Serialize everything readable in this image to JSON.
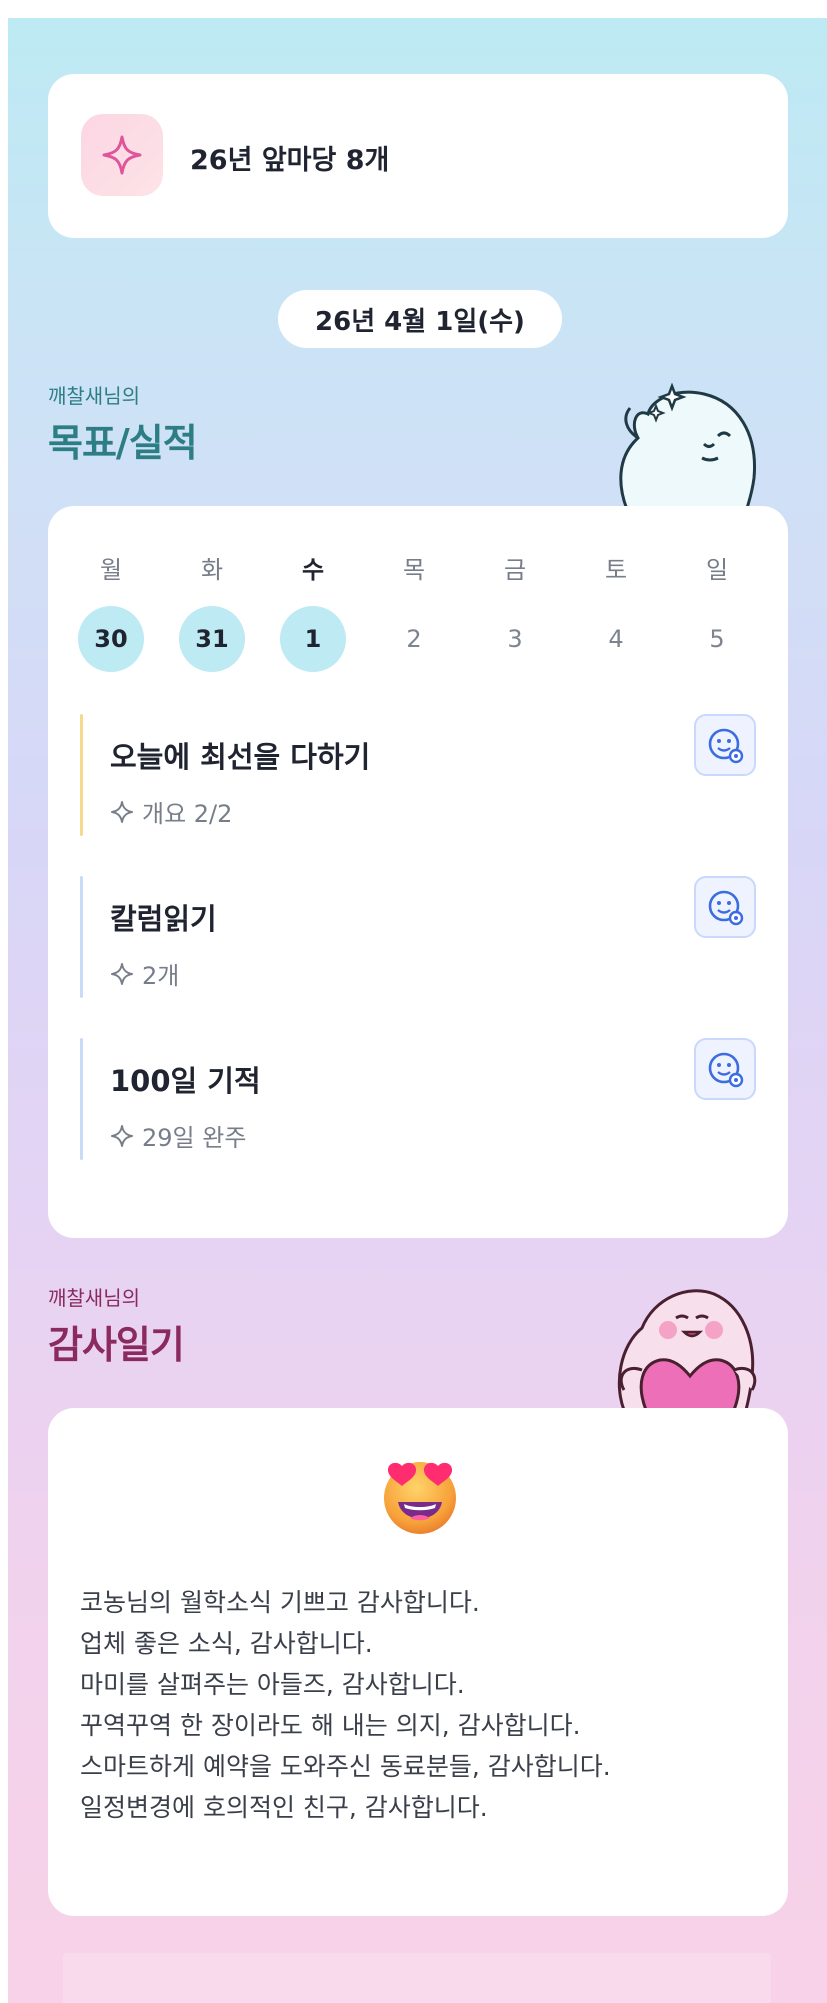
{
  "summary": {
    "text": "26년 앞마당 8개"
  },
  "date": {
    "label": "26년 4월 1일(수)"
  },
  "goals_section": {
    "subtitle": "깨찰새님의",
    "title": "목표/실적"
  },
  "week": {
    "days": [
      {
        "weekday": "월",
        "date": "30",
        "done": true
      },
      {
        "weekday": "화",
        "date": "31",
        "done": true
      },
      {
        "weekday": "수",
        "date": "1",
        "done": true,
        "today": true
      },
      {
        "weekday": "목",
        "date": "2",
        "done": false
      },
      {
        "weekday": "금",
        "date": "3",
        "done": false
      },
      {
        "weekday": "토",
        "date": "4",
        "done": false
      },
      {
        "weekday": "일",
        "date": "5",
        "done": false
      }
    ]
  },
  "goals": [
    {
      "title": "오늘에 최선을 다하기",
      "meta": "개요 2/2",
      "bar_color": "#f5d98e"
    },
    {
      "title": "칼럼읽기",
      "meta": "2개",
      "bar_color": "#c7dcf6"
    },
    {
      "title": "100일 기적",
      "meta": "29일 완주",
      "bar_color": "#c7dcf6"
    }
  ],
  "gratitude_section": {
    "subtitle": "깨찰새님의",
    "title": "감사일기"
  },
  "gratitude": {
    "emoji": "heart-eyes-emoji",
    "lines": [
      "코농님의 월학소식 기쁘고 감사합니다.",
      "업체 좋은 소식, 감사합니다.",
      "마미를 살펴주는 아들즈, 감사합니다.",
      "꾸역꾸역 한 장이라도 해 내는 의지, 감사합니다.",
      "스마트하게 예약을 도와주신 동료분들, 감사합니다.",
      "일정변경에 호의적인 친구, 감사합니다."
    ]
  },
  "colors": {
    "goals_accent": "#2d7d85",
    "gratitude_accent": "#8a2a5e",
    "done_day": "#bdeaf3",
    "icon_blue": "#3b6de0"
  }
}
